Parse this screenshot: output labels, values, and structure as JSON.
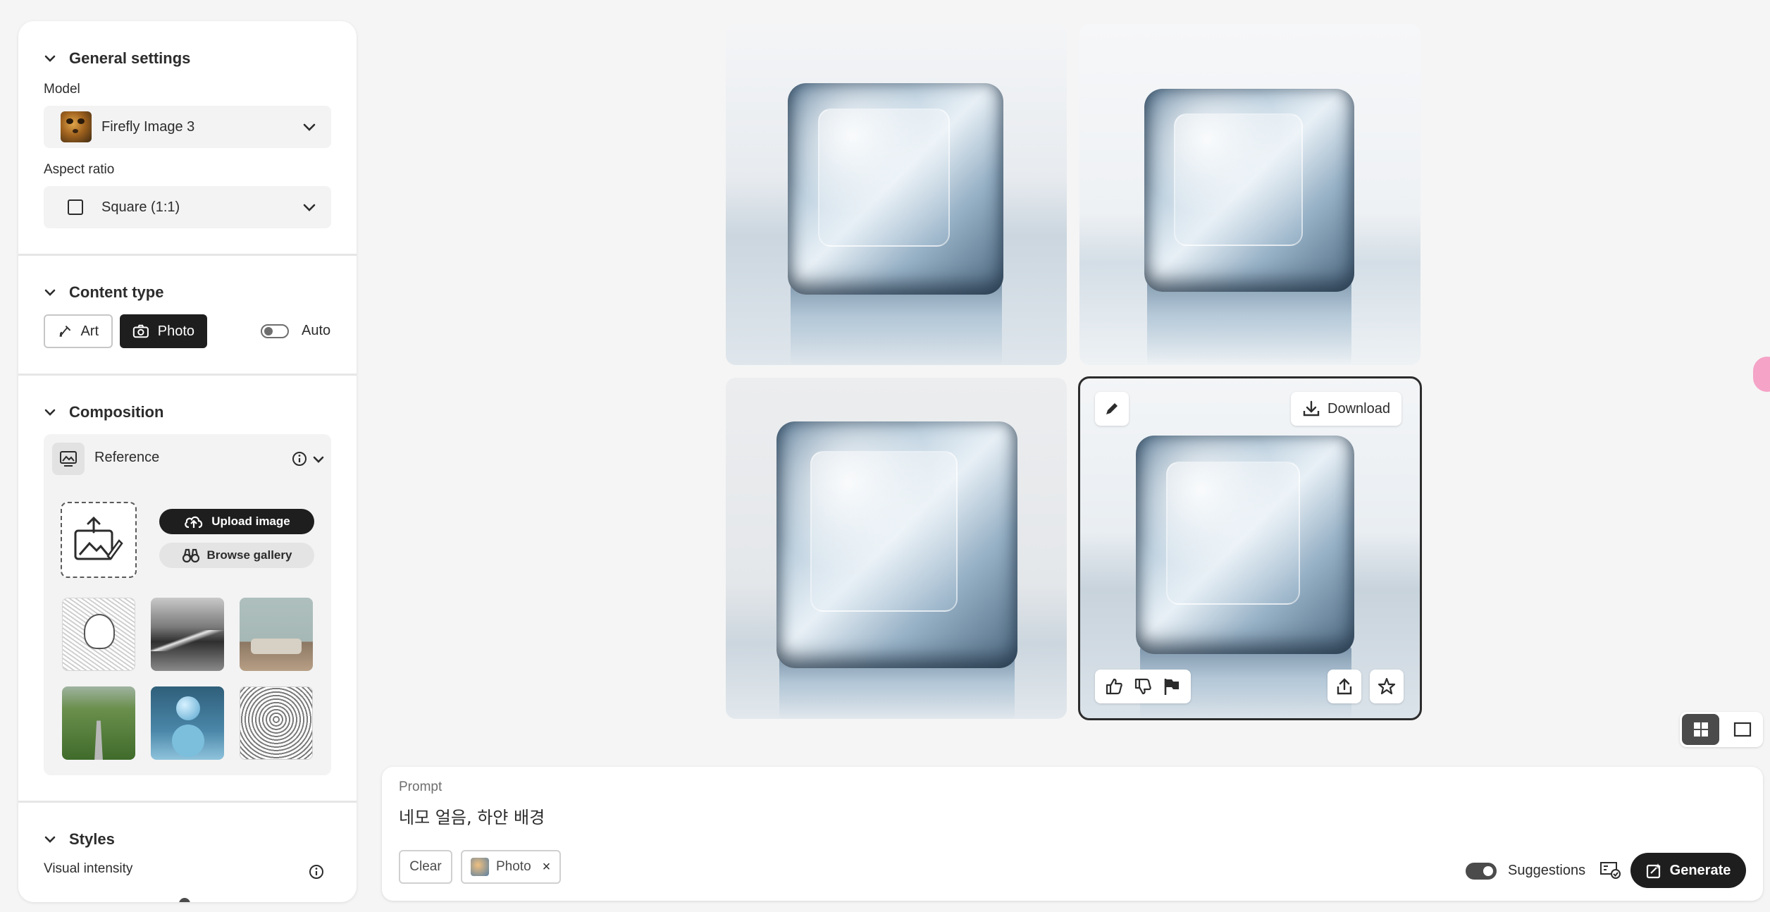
{
  "sidebar": {
    "general": {
      "title": "General settings",
      "model_label": "Model",
      "model_value": "Firefly Image 3",
      "aspect_label": "Aspect ratio",
      "aspect_value": "Square (1:1)"
    },
    "content_type": {
      "title": "Content type",
      "art_label": "Art",
      "photo_label": "Photo",
      "auto_label": "Auto",
      "selected": "Photo",
      "auto_enabled": false
    },
    "composition": {
      "title": "Composition",
      "reference_label": "Reference",
      "upload_label": "Upload image",
      "browse_label": "Browse gallery",
      "thumbnails": [
        {
          "icon": "bird-sketch"
        },
        {
          "icon": "mountain-river"
        },
        {
          "icon": "living-room"
        },
        {
          "icon": "road-field"
        },
        {
          "icon": "sphere-on-pedestal"
        },
        {
          "icon": "owl-sketch"
        }
      ]
    },
    "styles": {
      "title": "Styles",
      "visual_intensity_label": "Visual intensity"
    }
  },
  "gallery": {
    "selected_index": 3,
    "download_label": "Download",
    "tile_icons": [
      "edit-icon",
      "download-icon",
      "thumbs-up-icon",
      "thumbs-down-icon",
      "flag-icon",
      "share-icon",
      "star-icon"
    ]
  },
  "view_toggle": {
    "active": "grid"
  },
  "prompt": {
    "label": "Prompt",
    "text": "네모 얼음, 하얀 배경",
    "clear_label": "Clear",
    "chip_label": "Photo",
    "chip_remove": "×",
    "suggestions_label": "Suggestions",
    "suggestions_enabled": true,
    "generate_label": "Generate"
  },
  "colors": {
    "accent_dark": "#1e1e1e",
    "panel_bg": "#ffffff",
    "page_bg": "#f5f5f5"
  }
}
